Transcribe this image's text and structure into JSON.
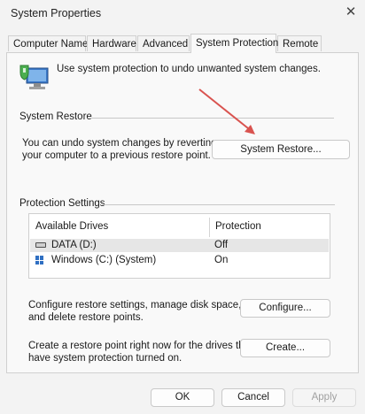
{
  "window": {
    "title": "System Properties",
    "close_glyph": "✕"
  },
  "tabs": [
    {
      "label": "Computer Name"
    },
    {
      "label": "Hardware"
    },
    {
      "label": "Advanced"
    },
    {
      "label": "System Protection"
    },
    {
      "label": "Remote"
    }
  ],
  "header": {
    "text": "Use system protection to undo unwanted system changes."
  },
  "system_restore": {
    "section_title": "System Restore",
    "description_line1": "You can undo system changes by reverting",
    "description_line2": "your computer to a previous restore point.",
    "button_label": "System Restore..."
  },
  "protection_settings": {
    "section_title": "Protection Settings",
    "columns": [
      "Available Drives",
      "Protection"
    ],
    "drives": [
      {
        "name": "DATA (D:)",
        "protection": "Off",
        "icon": "hard-drive-icon"
      },
      {
        "name": "Windows (C:) (System)",
        "protection": "On",
        "icon": "windows-drive-icon"
      }
    ],
    "configure_text_line1": "Configure restore settings, manage disk space,",
    "configure_text_line2": "and delete restore points.",
    "configure_label": "Configure...",
    "create_text_line1": "Create a restore point right now for the drives that",
    "create_text_line2": "have system protection turned on.",
    "create_label": "Create..."
  },
  "footer": {
    "ok_label": "OK",
    "cancel_label": "Cancel",
    "apply_label": "Apply"
  },
  "colors": {
    "annotation_arrow": "#d9534f",
    "accent": "#2f6fc2"
  }
}
